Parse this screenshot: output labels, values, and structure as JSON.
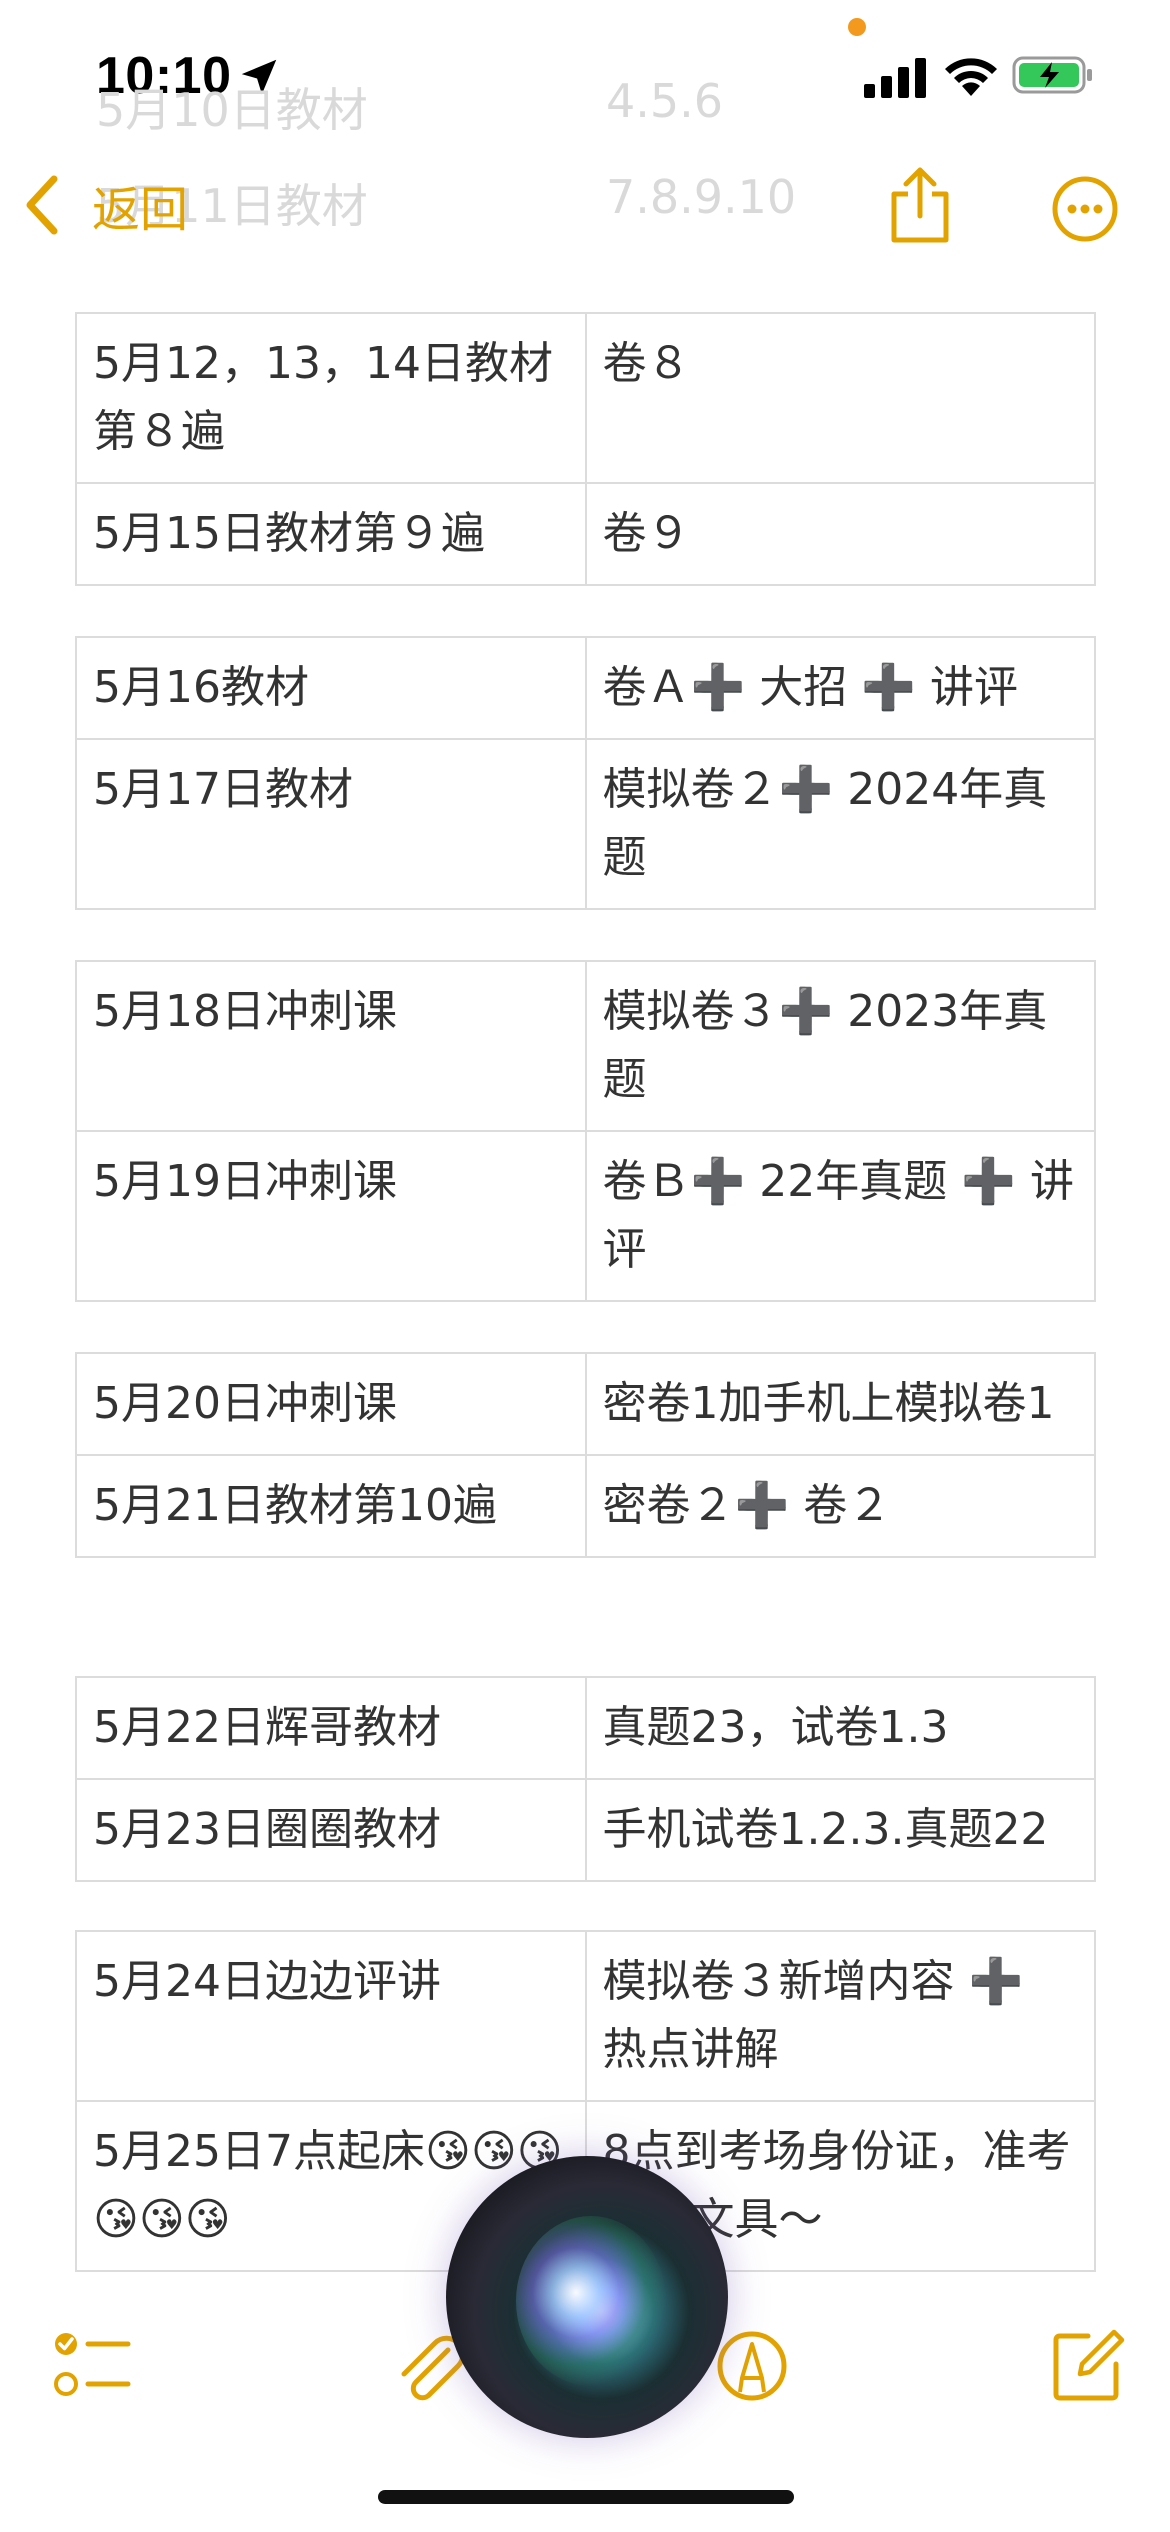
{
  "status_bar": {
    "time": "10:10"
  },
  "ghost_rows": [
    {
      "left": "5月10日教材",
      "right": "4.5.6"
    },
    {
      "left": "5月11日教材",
      "right": "7.8.9.10"
    }
  ],
  "nav": {
    "back_label": "返回"
  },
  "tables": [
    {
      "rows": [
        {
          "a": "5月12，13，14日教材第８遍",
          "b": "卷８"
        },
        {
          "a": "5月15日教材第９遍",
          "b": "卷９"
        }
      ]
    },
    {
      "rows": [
        {
          "a": "5月16教材",
          "b": "卷Ａ➕ 大招 ➕ 讲评"
        },
        {
          "a": "5月17日教材",
          "b": "模拟卷２➕ 2024年真题"
        }
      ]
    },
    {
      "rows": [
        {
          "a": "5月18日冲刺课",
          "b": "模拟卷３➕ 2023年真题"
        },
        {
          "a": "5月19日冲刺课",
          "b": "卷Ｂ➕ 22年真题 ➕ 讲评"
        }
      ]
    },
    {
      "rows": [
        {
          "a": "5月20日冲刺课",
          "b": "密卷1加手机上模拟卷1"
        },
        {
          "a": "5月21日教材第10遍",
          "b": "密卷２➕ 卷２"
        }
      ]
    },
    {
      "rows": [
        {
          "a": "5月22日辉哥教材",
          "b": "真题23，试卷1.3"
        },
        {
          "a": "5月23日圈圈教材",
          "b": "手机试卷1.2.3.真题22"
        }
      ]
    },
    {
      "rows": [
        {
          "a": "5月24日边边评讲",
          "b": "模拟卷３新增内容 ➕ 热点讲解"
        },
        {
          "a": "5月25日7点起床😘😘😘😘😘😘",
          "b": "8点到考场身份证，准考证，文具～"
        }
      ]
    }
  ],
  "colors": {
    "accent": "#e2a300",
    "border": "#dcdcdc",
    "text": "#333333"
  },
  "icons": [
    "location-arrow-icon",
    "signal-icon",
    "wifi-icon",
    "battery-charging-icon",
    "chevron-left-icon",
    "share-icon",
    "more-icon",
    "checklist-icon",
    "paperclip-icon",
    "markup-pen-icon",
    "compose-icon"
  ]
}
